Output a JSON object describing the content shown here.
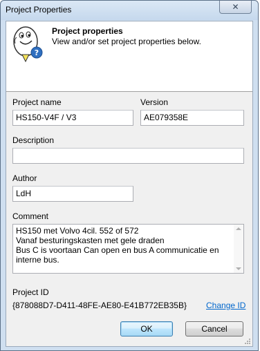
{
  "window": {
    "title": "Project Properties"
  },
  "header": {
    "title": "Project properties",
    "subtitle": "View and/or set project properties below.",
    "icon": "assistant-help-icon"
  },
  "fields": {
    "project_name_label": "Project name",
    "project_name_value": "HS150-V4F / V3",
    "version_label": "Version",
    "version_value": "AE079358E",
    "description_label": "Description",
    "description_value": "",
    "author_label": "Author",
    "author_value": "LdH",
    "comment_label": "Comment",
    "comment_lines": [
      "HS150 met Volvo 4cil. 552 of 572",
      "Vanaf besturingskasten met gele draden",
      "Bus C is voortaan Can open en bus A communicatie en",
      "interne bus."
    ],
    "project_id_label": "Project ID",
    "project_id_value": "{878088D7-D411-48FE-AE80-E41B772EB35B}",
    "change_id_link": "Change ID"
  },
  "buttons": {
    "ok": "OK",
    "cancel": "Cancel"
  },
  "colors": {
    "frame": "#cfdff0",
    "client": "#f0f0f0",
    "link": "#0066cc",
    "default_button_border": "#3c7fb1"
  }
}
